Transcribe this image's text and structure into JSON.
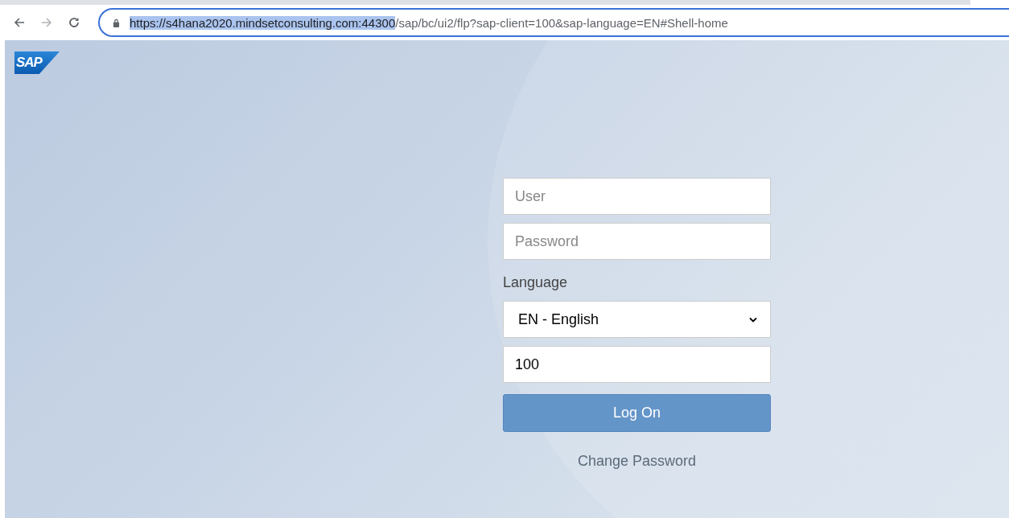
{
  "browser": {
    "url_segments": [
      {
        "text": "https://s4hana2020.mindsetconsulting.com:44300",
        "selected": true
      },
      {
        "text": "/sap/bc/ui2/flp?sap-client=100&sap-language=EN#Shell-home",
        "selected": false
      }
    ],
    "forward_disabled": true
  },
  "logo": {
    "text": "SAP"
  },
  "login": {
    "fields": [
      {
        "kind": "text",
        "placeholder": "User"
      },
      {
        "kind": "text",
        "placeholder": "Password"
      },
      {
        "kind": "label",
        "text": "Language"
      },
      {
        "kind": "select",
        "value": "EN - English"
      },
      {
        "kind": "text",
        "value": "100"
      }
    ],
    "button": "Log On",
    "link": "Change Password"
  }
}
